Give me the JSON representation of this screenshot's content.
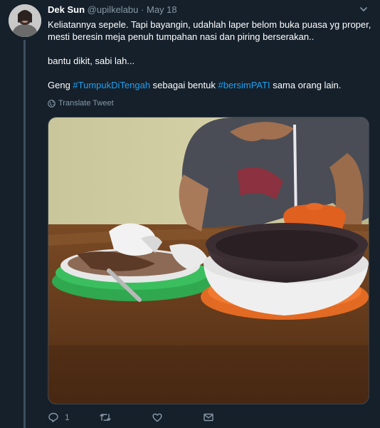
{
  "tweet": {
    "author": {
      "name": "Dek Sun",
      "handle": "@upilkelabu",
      "separator": "·",
      "date": "May 18"
    },
    "text": {
      "line1": "Keliatannya sepele. Tapi bayangin, udahlah laper belom buka puasa yg proper, mesti beresin meja penuh tumpahan nasi dan piring berserakan..",
      "line2": "bantu dikit, sabi lah...",
      "line3_prefix": "Geng ",
      "hashtag1": "#TumpukDiTengah",
      "line3_mid": " sebagai bentuk ",
      "hashtag2": "#bersimPATI",
      "line3_suffix": " sama orang lain."
    },
    "translate_label": "Translate Tweet",
    "actions": {
      "reply_count": "1"
    },
    "icons": {
      "caret": "chevron-down-icon",
      "globe": "globe-icon",
      "reply": "reply-icon",
      "retweet": "retweet-icon",
      "like": "like-icon",
      "dm": "envelope-icon"
    },
    "colors": {
      "background": "#15202b",
      "link": "#1da1f2",
      "muted": "#8899a6"
    }
  }
}
